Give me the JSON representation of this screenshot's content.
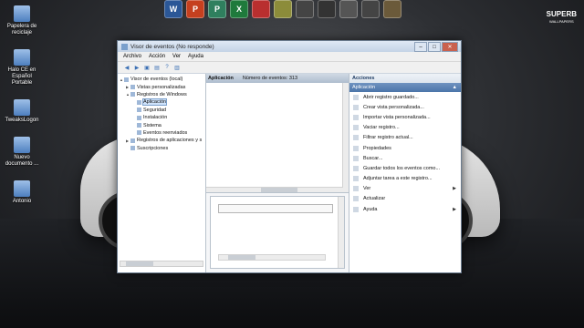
{
  "desktop": {
    "icons": [
      {
        "label": "Papelera de reciclaje"
      },
      {
        "label": "Halo CE en Español Portable"
      },
      {
        "label": "TweaksLogon"
      },
      {
        "label": "Nuevo documento ..."
      },
      {
        "label": "Antonio"
      }
    ],
    "brand_main": "SUPERB",
    "brand_sub": "WALLPAPERS"
  },
  "taskbar": {
    "items": [
      {
        "glyph": "W",
        "color": "#2b5797"
      },
      {
        "glyph": "P",
        "color": "#c5401f"
      },
      {
        "glyph": "P",
        "color": "#2f7f5e"
      },
      {
        "glyph": "X",
        "color": "#1f7a3c"
      },
      {
        "glyph": "",
        "color": "#b92f2f"
      },
      {
        "glyph": "",
        "color": "#8c8c3a"
      },
      {
        "glyph": "",
        "color": "#444"
      },
      {
        "glyph": "",
        "color": "#333"
      },
      {
        "glyph": "",
        "color": "#555"
      },
      {
        "glyph": "",
        "color": "#444"
      },
      {
        "glyph": "",
        "color": "#6b5a3a"
      }
    ]
  },
  "window": {
    "title": "Visor de eventos (No responde)",
    "menu": [
      "Archivo",
      "Acción",
      "Ver",
      "Ayuda"
    ],
    "tree": [
      {
        "label": "Visor de eventos (local)",
        "indent": 0,
        "arrow": "▲"
      },
      {
        "label": "Vistas personalizadas",
        "indent": 1,
        "arrow": "▶"
      },
      {
        "label": "Registros de Windows",
        "indent": 1,
        "arrow": "▲"
      },
      {
        "label": "Aplicación",
        "indent": 2,
        "arrow": "",
        "selected": true
      },
      {
        "label": "Seguridad",
        "indent": 2,
        "arrow": ""
      },
      {
        "label": "Instalación",
        "indent": 2,
        "arrow": ""
      },
      {
        "label": "Sistema",
        "indent": 2,
        "arrow": ""
      },
      {
        "label": "Eventos reenviados",
        "indent": 2,
        "arrow": ""
      },
      {
        "label": "Registros de aplicaciones y s",
        "indent": 1,
        "arrow": "▶"
      },
      {
        "label": "Suscripciones",
        "indent": 1,
        "arrow": ""
      }
    ],
    "center": {
      "log_name": "Aplicación",
      "event_count": "Número de eventos: 313"
    },
    "actions": {
      "header": "Acciones",
      "section": "Aplicación",
      "items": [
        {
          "label": "Abrir registro guardado...",
          "submenu": false
        },
        {
          "label": "Crear vista personalizada...",
          "submenu": false
        },
        {
          "label": "Importar vista personalizada...",
          "submenu": false
        },
        {
          "label": "Vaciar registro...",
          "submenu": false
        },
        {
          "label": "Filtrar registro actual...",
          "submenu": false
        },
        {
          "label": "Propiedades",
          "submenu": false
        },
        {
          "label": "Buscar...",
          "submenu": false
        },
        {
          "label": "Guardar todos los eventos como...",
          "submenu": false
        },
        {
          "label": "Adjuntar tarea a este registro...",
          "submenu": false
        },
        {
          "label": "Ver",
          "submenu": true
        },
        {
          "label": "Actualizar",
          "submenu": false
        },
        {
          "label": "Ayuda",
          "submenu": true
        }
      ]
    }
  }
}
